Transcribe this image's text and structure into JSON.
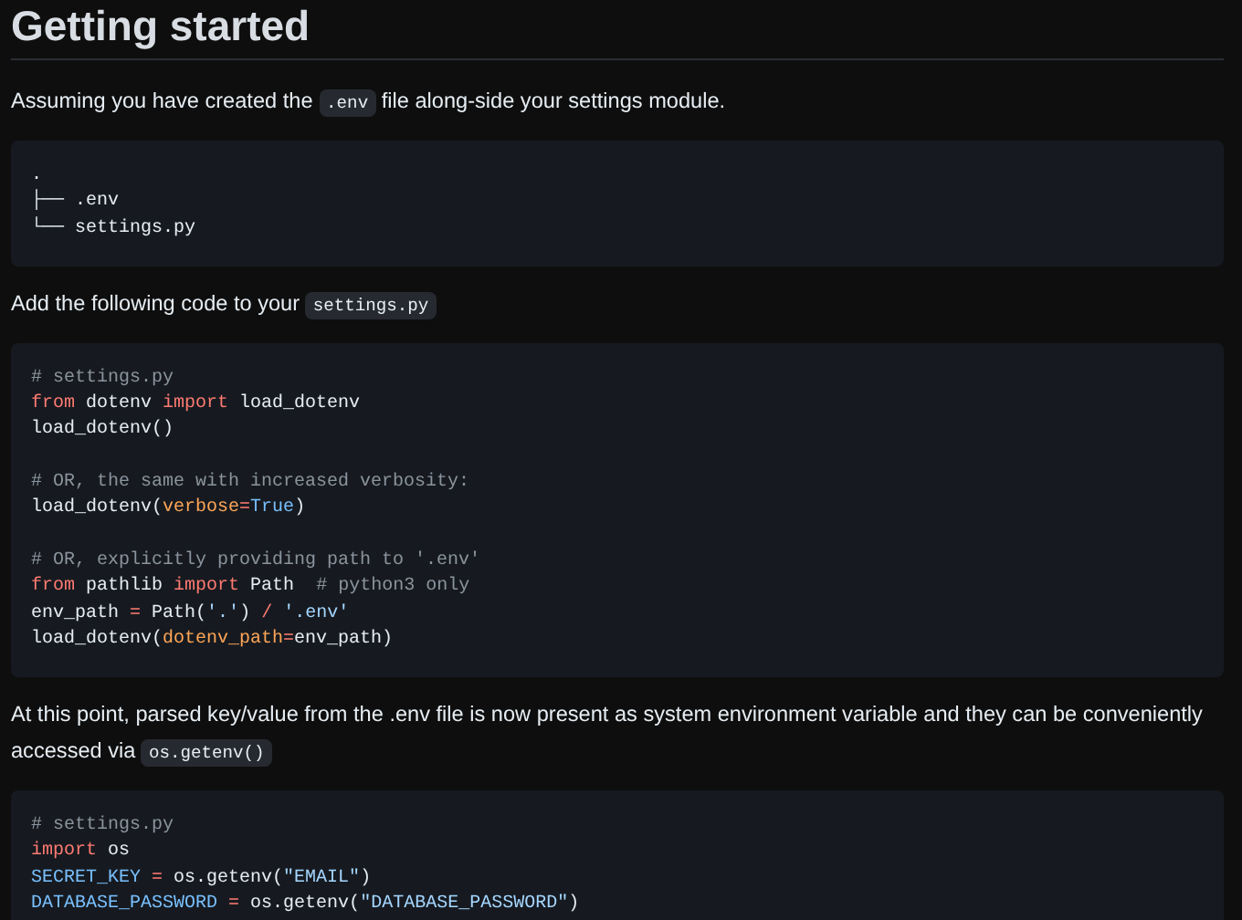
{
  "heading": "Getting started",
  "blocks": [
    {
      "kind": "paragraph",
      "parts": [
        {
          "kind": "text",
          "t": "Assuming you have created the "
        },
        {
          "kind": "code",
          "t": ".env"
        },
        {
          "kind": "text",
          "t": " file along-side your settings module."
        }
      ]
    },
    {
      "kind": "code",
      "sections": [
        [
          [
            {
              "kind": "plain",
              "t": "."
            }
          ],
          [
            {
              "kind": "plain",
              "t": "├── .env"
            }
          ],
          [
            {
              "kind": "plain",
              "t": "└── settings.py"
            }
          ]
        ]
      ]
    },
    {
      "kind": "paragraph",
      "parts": [
        {
          "kind": "text",
          "t": "Add the following code to your "
        },
        {
          "kind": "code",
          "t": "settings.py"
        }
      ]
    },
    {
      "kind": "code",
      "sections": [
        [
          [
            {
              "kind": "cm",
              "t": "# settings.py"
            }
          ],
          [
            {
              "kind": "kw",
              "t": "from"
            },
            {
              "kind": "plain",
              "t": " dotenv "
            },
            {
              "kind": "kw",
              "t": "import"
            },
            {
              "kind": "plain",
              "t": " load_dotenv"
            }
          ],
          [
            {
              "kind": "plain",
              "t": "load_dotenv()"
            }
          ]
        ],
        [
          [
            {
              "kind": "cm",
              "t": "# OR, the same with increased verbosity:"
            }
          ],
          [
            {
              "kind": "plain",
              "t": "load_dotenv("
            },
            {
              "kind": "attr",
              "t": "verbose"
            },
            {
              "kind": "kw",
              "t": "="
            },
            {
              "kind": "const",
              "t": "True"
            },
            {
              "kind": "plain",
              "t": ")"
            }
          ]
        ],
        [
          [
            {
              "kind": "cm",
              "t": "# OR, explicitly providing path to '.env'"
            }
          ],
          [
            {
              "kind": "kw",
              "t": "from"
            },
            {
              "kind": "plain",
              "t": " pathlib "
            },
            {
              "kind": "kw",
              "t": "import"
            },
            {
              "kind": "plain",
              "t": " Path  "
            },
            {
              "kind": "cm",
              "t": "# python3 only"
            }
          ],
          [
            {
              "kind": "plain",
              "t": "env_path "
            },
            {
              "kind": "kw",
              "t": "="
            },
            {
              "kind": "plain",
              "t": " Path("
            },
            {
              "kind": "str",
              "t": "'.'"
            },
            {
              "kind": "plain",
              "t": ")"
            },
            {
              "kind": "kw",
              "t": " / "
            },
            {
              "kind": "str",
              "t": "'.env'"
            }
          ],
          [
            {
              "kind": "plain",
              "t": "load_dotenv("
            },
            {
              "kind": "attr",
              "t": "dotenv_path"
            },
            {
              "kind": "kw",
              "t": "="
            },
            {
              "kind": "plain",
              "t": "env_path)"
            }
          ]
        ]
      ]
    },
    {
      "kind": "paragraph",
      "parts": [
        {
          "kind": "text",
          "t": "At this point, parsed key/value from the .env file is now present as system environment variable and they can be conveniently accessed via "
        },
        {
          "kind": "code",
          "t": "os.getenv()"
        }
      ]
    },
    {
      "kind": "code",
      "sections": [
        [
          [
            {
              "kind": "cm",
              "t": "# settings.py"
            }
          ],
          [
            {
              "kind": "kw",
              "t": "import"
            },
            {
              "kind": "plain",
              "t": " os"
            }
          ],
          [
            {
              "kind": "const",
              "t": "SECRET_KEY"
            },
            {
              "kind": "kw",
              "t": " = "
            },
            {
              "kind": "plain",
              "t": "os.getenv("
            },
            {
              "kind": "str",
              "t": "\"EMAIL\""
            },
            {
              "kind": "plain",
              "t": ")"
            }
          ],
          [
            {
              "kind": "const",
              "t": "DATABASE_PASSWORD"
            },
            {
              "kind": "kw",
              "t": " = "
            },
            {
              "kind": "plain",
              "t": "os.getenv("
            },
            {
              "kind": "str",
              "t": "\"DATABASE_PASSWORD\""
            },
            {
              "kind": "plain",
              "t": ")"
            }
          ]
        ]
      ]
    }
  ]
}
